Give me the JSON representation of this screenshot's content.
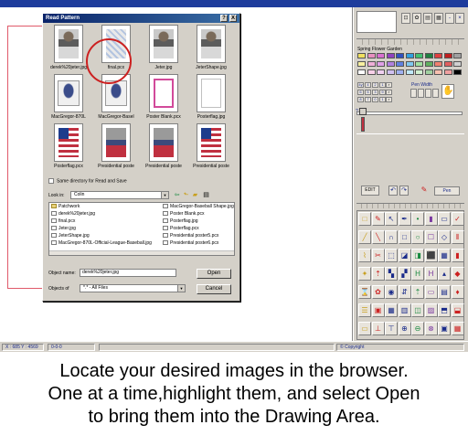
{
  "dialog": {
    "title": "Read Pattern",
    "help_btn": "?",
    "close_btn": "X",
    "thumbnails": [
      {
        "label": "derek%20jeter.jpg",
        "kind": "player"
      },
      {
        "label": "final.pcx",
        "kind": "cards"
      },
      {
        "label": "Jeter.jpg",
        "kind": "player"
      },
      {
        "label": "JeterShape.jpg",
        "kind": "player"
      },
      {
        "label": "MacGregor-870L",
        "kind": "shirt"
      },
      {
        "label": "MacGregor-Basel",
        "kind": "shirt"
      },
      {
        "label": "Poster Blank.pcx",
        "kind": "pink"
      },
      {
        "label": "Posterflag.jpg",
        "kind": "plain"
      },
      {
        "label": "Posterflag.pcx",
        "kind": "flag"
      },
      {
        "label": "Presidential poste",
        "kind": "presid"
      },
      {
        "label": "Presidential poste",
        "kind": "presid"
      },
      {
        "label": "Presidential poste",
        "kind": "flag"
      }
    ],
    "same_dir_label": "Same directory for Read and Save",
    "look_in_label": "Look in:",
    "look_in_value": "Colin",
    "files": [
      {
        "name": "Patchwork",
        "type": "folder"
      },
      {
        "name": "derek%20jeter.jpg",
        "type": "file"
      },
      {
        "name": "final.pcx",
        "type": "file"
      },
      {
        "name": "Jeter.jpg",
        "type": "file"
      },
      {
        "name": "JeterShape.jpg",
        "type": "file"
      },
      {
        "name": "MacGregor-870L-Official-League-Baseball.jpg",
        "type": "file"
      },
      {
        "name": "MacGregor-Baseball Shape.jpg",
        "type": "file"
      },
      {
        "name": "Poster Blank.pcx",
        "type": "file"
      },
      {
        "name": "Posterflag.jpg",
        "type": "file"
      },
      {
        "name": "Posterflag.pcx",
        "type": "file"
      },
      {
        "name": "Presidential poster5.pcx",
        "type": "file"
      },
      {
        "name": "Presidential poster6.pcx",
        "type": "file"
      }
    ],
    "object_name_label": "Object name:",
    "object_name_value": "derek%20jeter.jpg",
    "objects_of_label": "Objects of",
    "objects_of_value": "*.* - All Files",
    "open_btn": "Open",
    "cancel_btn": "Cancel"
  },
  "panel": {
    "palette_name": "Spring Flower Garden",
    "pen_width_label": "Pen Width",
    "edit_btn": "EDIT",
    "pen_btn": "Pen",
    "number_buttons": [
      "4y",
      "4",
      "2",
      "1",
      "6",
      "5",
      "3",
      "9",
      "8",
      "7",
      "0",
      "1"
    ],
    "swatch_colors": [
      "#f0e060",
      "#e890c0",
      "#d870d0",
      "#9040c0",
      "#3050c0",
      "#30a0e0",
      "#40c070",
      "#208040",
      "#e04040",
      "#c02020",
      "#a0a0a0",
      "#f8f0a0",
      "#f0b0d8",
      "#e0a0e8",
      "#b080e0",
      "#6080e0",
      "#80c8f0",
      "#a0e0a0",
      "#60b060",
      "#f08070",
      "#e06060",
      "#d0d0d0",
      "#ffffff",
      "#f8d0e8",
      "#f0d0f0",
      "#d0c0f0",
      "#a0b0f0",
      "#c0e8f8",
      "#d0f0d0",
      "#a0d0a0",
      "#f8c0b0",
      "#f0a0a0",
      "#000000"
    ],
    "tools": [
      "□",
      "✎",
      "↖",
      "✒",
      "•",
      "▮",
      "▭",
      "✓",
      "╱",
      "╲",
      "∩",
      "□",
      "○",
      "☐",
      "◇",
      "⦀",
      "⌇",
      "✂",
      "⬚",
      "◪",
      "◨",
      "⬛",
      "▦",
      "▮",
      "✦",
      "⇡",
      "▚",
      "▞",
      "H",
      "H",
      "▴",
      "◆",
      "⌛",
      "✿",
      "◉",
      "⇵",
      "⇡",
      "▭",
      "▤",
      "♦",
      "☰",
      "▣",
      "▦",
      "▥",
      "◫",
      "▨",
      "⬒",
      "⬓",
      "▭",
      "⊥",
      "⊤",
      "⊕",
      "⊖",
      "⊗",
      "▣",
      "▦"
    ]
  },
  "status": {
    "coords": "X : 685 Y : 4569",
    "zero": "0-0-0",
    "copyright": "Copyright"
  },
  "caption": {
    "line1": "Locate your desired images in the browser.",
    "line2": "One at a time,highlight them, and select Open",
    "line3": "to bring them into the Drawing Area."
  }
}
